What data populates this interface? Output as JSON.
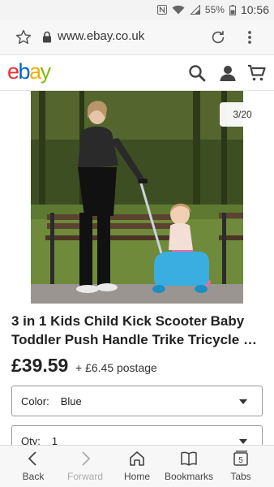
{
  "status_bar": {
    "battery_percent": "55%",
    "time": "10:56",
    "icons": [
      "nfc-icon",
      "wifi-icon",
      "signal-icon",
      "battery-icon"
    ]
  },
  "browser": {
    "url": "www.ebay.co.uk",
    "icons": [
      "star-icon",
      "lock-icon",
      "reload-icon",
      "overflow-menu-icon"
    ]
  },
  "header": {
    "logo_letters": [
      "e",
      "b",
      "a",
      "y"
    ],
    "logo_colors": [
      "#e53238",
      "#0064d2",
      "#f5af02",
      "#86b817"
    ],
    "icons": [
      "search-icon",
      "user-icon",
      "cart-icon"
    ]
  },
  "product": {
    "image_counter": "3/20",
    "title_line1": "3 in 1 Kids Child Kick Scooter Baby",
    "title_line2": "Toddler Push Handle Trike Tricycle Sea…",
    "price": "£39.59",
    "postage": "+ £6.45 postage"
  },
  "options": {
    "color_label": "Color:",
    "color_value": "Blue",
    "qty_label": "Qty:",
    "qty_value": "1"
  },
  "bottom_nav": {
    "back": "Back",
    "forward": "Forward",
    "home": "Home",
    "bookmarks": "Bookmarks",
    "tabs": "Tabs",
    "tab_count": "5"
  }
}
